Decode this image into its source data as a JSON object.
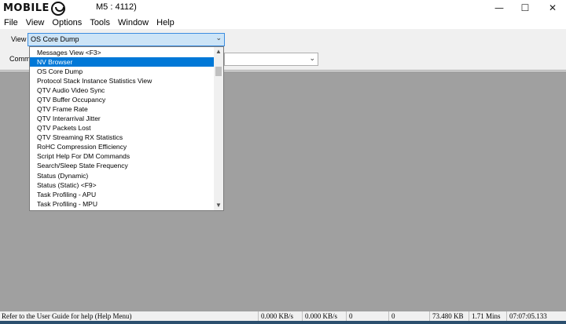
{
  "window": {
    "logo_text": "MOBILE",
    "title": "M5 : 4112)",
    "minimize": "—",
    "maximize": "☐",
    "close": "✕"
  },
  "menu": [
    "File",
    "View",
    "Options",
    "Tools",
    "Window",
    "Help"
  ],
  "toolbar": {
    "view_label": "View",
    "view_value": "OS Core Dump",
    "command_label": "Comma"
  },
  "dropdown": {
    "items": [
      "Messages View <F3>",
      "NV Browser",
      "OS Core Dump",
      "Protocol Stack Instance Statistics View",
      "QTV Audio Video Sync",
      "QTV Buffer Occupancy",
      "QTV Frame Rate",
      "QTV Interarrival Jitter",
      "QTV Packets Lost",
      "QTV Streaming RX Statistics",
      "RoHC Compression Efficiency",
      "Script Help For DM Commands",
      "Search/Sleep State Frequency",
      "Status (Dynamic)",
      "Status (Static) <F9>",
      "Task Profiling - APU",
      "Task Profiling - MPU"
    ],
    "selected_index": 1
  },
  "statusbar": {
    "help": "Refer to the User Guide for help (Help Menu)",
    "rx_rate": "0.000 KB/s",
    "tx_rate": "0.000 KB/s",
    "count1": "0",
    "count2": "0",
    "size": "73.480 KB",
    "duration": "1.71 Mins",
    "time": "07:07:05.133"
  }
}
